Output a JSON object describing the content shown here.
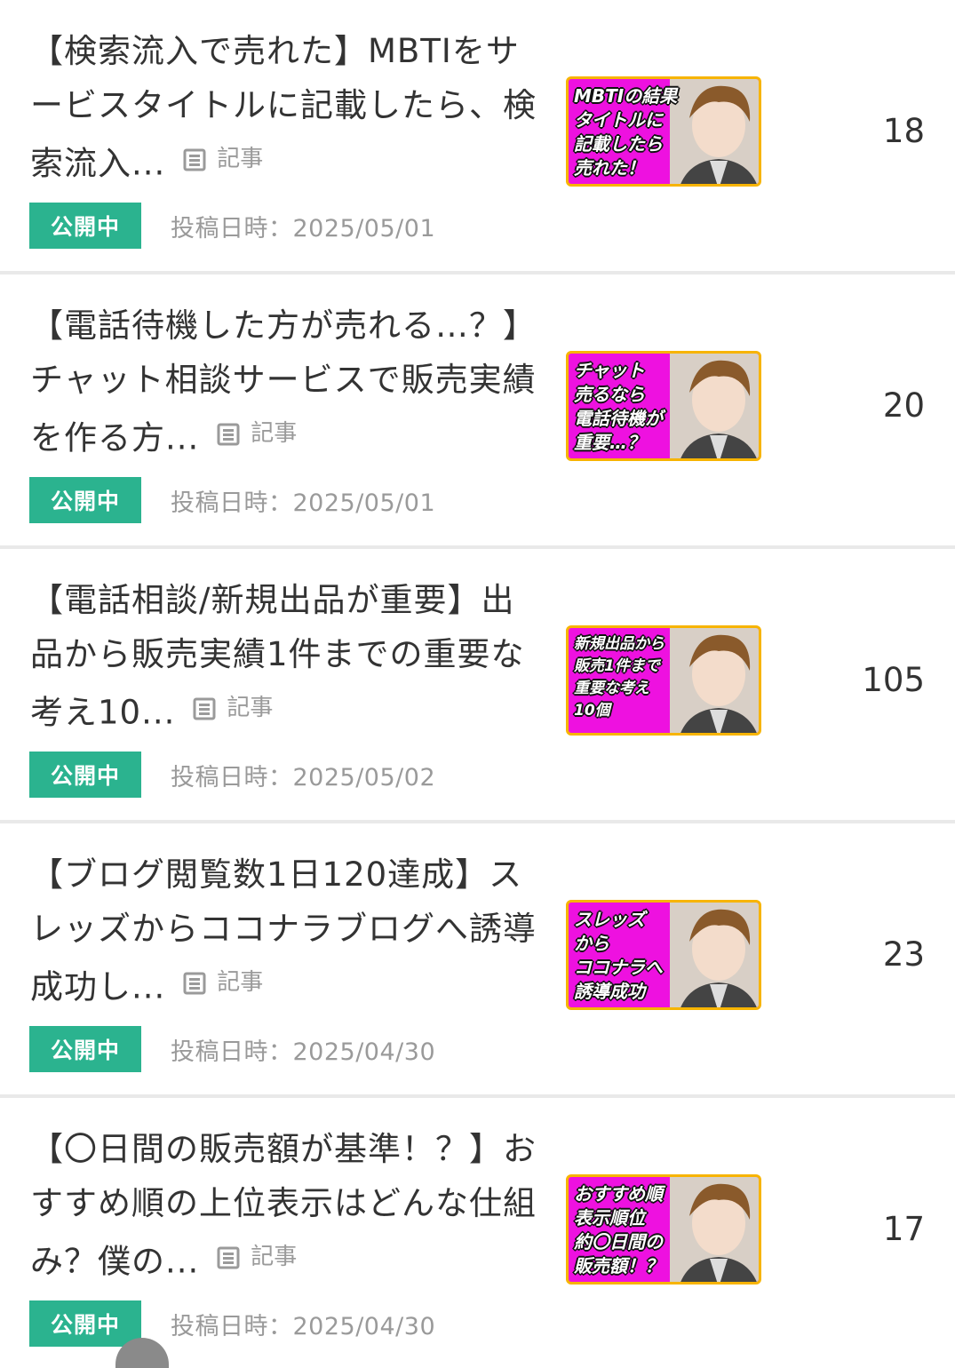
{
  "articles": [
    {
      "title": "【検索流入で売れた】MBTIをサービスタイトルに記載したら、検索流入...",
      "kind_label": "記事",
      "status": "公開中",
      "date": "投稿日時：2025/05/01",
      "thumbnail_text": "MBTIの結果\nタイトルに\n記載したら\n売れた！",
      "count": "18"
    },
    {
      "title": "【電話待機した方が売れる…？】チャット相談サービスで販売実績を作る方...",
      "kind_label": "記事",
      "status": "公開中",
      "date": "投稿日時：2025/05/01",
      "thumbnail_text": "チャット\n売るなら\n電話待機が\n重要…？",
      "count": "20"
    },
    {
      "title": "【電話相談/新規出品が重要】出品から販売実績1件までの重要な考え10...",
      "kind_label": "記事",
      "status": "公開中",
      "date": "投稿日時：2025/05/02",
      "thumbnail_text": "新規出品から\n販売1件まで\n重要な考え\n10個",
      "count": "105"
    },
    {
      "title": "【ブログ閲覧数1日120達成】スレッズからココナラブログへ誘導成功し...",
      "kind_label": "記事",
      "status": "公開中",
      "date": "投稿日時：2025/04/30",
      "thumbnail_text": "スレッズ\nから\nココナラへ\n誘導成功",
      "count": "23"
    },
    {
      "title": "【〇日間の販売額が基準！？】おすすめ順の上位表示はどんな仕組み？僕の...",
      "kind_label": "記事",
      "status": "公開中",
      "date": "投稿日時：2025/04/30",
      "thumbnail_text": "おすすめ順\n表示順位\n約〇日間の\n販売額！？",
      "count": "17"
    }
  ],
  "colors": {
    "badge_bg": "#2bb38f",
    "thumbnail_bg": "#ee11e0",
    "thumbnail_border": "#f7b400",
    "divider": "#e9e9e9"
  },
  "icons": {
    "kind_icon": "document-icon"
  }
}
